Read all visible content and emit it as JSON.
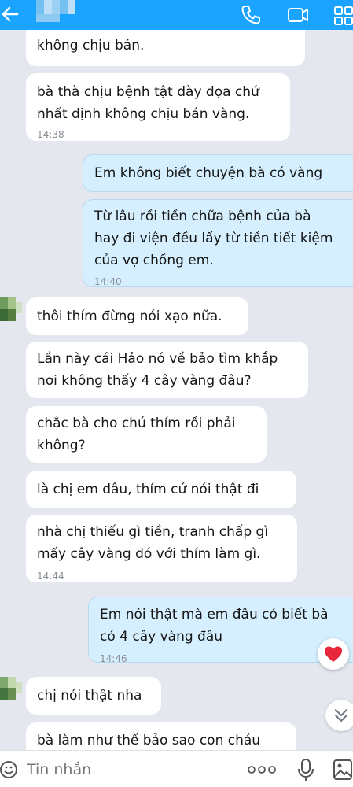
{
  "header": {
    "back_icon": "arrow-left-icon",
    "actions": [
      "phone-icon",
      "video-camera-icon",
      "grid-menu-icon"
    ],
    "accent": "#1aa3ff"
  },
  "messages": [
    {
      "side": "in",
      "lines": [
        "không chịu bán."
      ]
    },
    {
      "side": "in",
      "lines": [
        "bà thà chịu bệnh tật đày đọa chứ",
        "nhất định không chịu bán vàng."
      ],
      "time": "14:38"
    },
    {
      "side": "out",
      "lines": [
        "Em không biết chuyện bà có vàng"
      ]
    },
    {
      "side": "out",
      "lines": [
        "Từ lâu rồi tiền chữa bệnh của bà",
        "hay đi viện đều lấy từ tiền tiết kiệm",
        "của vợ chồng em."
      ],
      "time": "14:40"
    },
    {
      "side": "in",
      "lines": [
        "thôi thím đừng nói xạo nữa."
      ]
    },
    {
      "side": "in",
      "lines": [
        "Lần này cái Hảo nó về bảo tìm khắp",
        "nơi không thấy 4 cây vàng đâu?"
      ]
    },
    {
      "side": "in",
      "lines": [
        "chắc bà cho chú thím rồi phải",
        "không?"
      ]
    },
    {
      "side": "in",
      "lines": [
        "là chị em dâu, thím cứ nói thật đi"
      ]
    },
    {
      "side": "in",
      "lines": [
        "nhà chị thiếu gì tiền, tranh chấp gì",
        "mấy cây vàng đó với thím làm gì."
      ],
      "time": "14:44"
    },
    {
      "side": "out",
      "lines": [
        "Em nói thật mà em đâu có biết bà",
        "có 4 cây vàng đâu"
      ],
      "time": "14:46",
      "reaction": "heart-icon"
    },
    {
      "side": "in",
      "lines": [
        "chị nói thật nha"
      ]
    },
    {
      "side": "in",
      "lines": [
        "bà làm như thế bảo sao con cháu"
      ]
    }
  ],
  "composer": {
    "placeholder": "Tin nhắn",
    "icons": [
      "sticker-icon",
      "more-dots-icon",
      "microphone-icon",
      "image-icon"
    ]
  },
  "scroll_down_icon": "double-chevron-down-icon"
}
